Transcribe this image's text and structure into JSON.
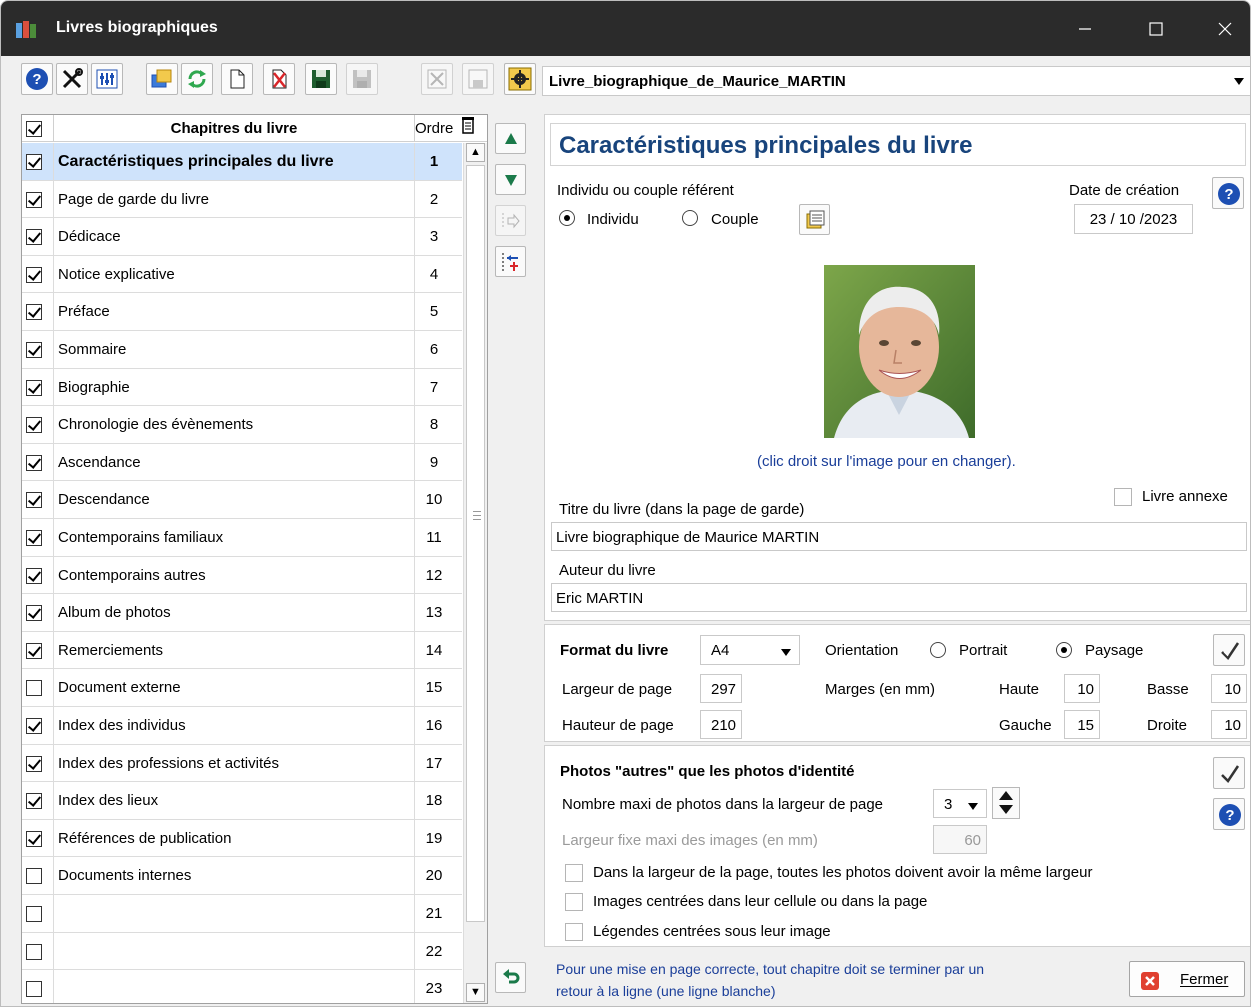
{
  "window": {
    "title": "Livres biographiques"
  },
  "toolbar": {
    "book_selector": "Livre_biographique_de_Maurice_MARTIN"
  },
  "chapters": {
    "header_name": "Chapitres du livre",
    "header_order": "Ordre",
    "rows": [
      {
        "label": "Caractéristiques principales du livre",
        "order": "1",
        "checked": true
      },
      {
        "label": "Page de garde du livre",
        "order": "2",
        "checked": true
      },
      {
        "label": "Dédicace",
        "order": "3",
        "checked": true
      },
      {
        "label": "Notice explicative",
        "order": "4",
        "checked": true
      },
      {
        "label": "Préface",
        "order": "5",
        "checked": true
      },
      {
        "label": "Sommaire",
        "order": "6",
        "checked": true
      },
      {
        "label": "Biographie",
        "order": "7",
        "checked": true
      },
      {
        "label": "Chronologie des évènements",
        "order": "8",
        "checked": true
      },
      {
        "label": "Ascendance",
        "order": "9",
        "checked": true
      },
      {
        "label": "Descendance",
        "order": "10",
        "checked": true
      },
      {
        "label": "Contemporains familiaux",
        "order": "11",
        "checked": true
      },
      {
        "label": "Contemporains autres",
        "order": "12",
        "checked": true
      },
      {
        "label": "Album de photos",
        "order": "13",
        "checked": true
      },
      {
        "label": "Remerciements",
        "order": "14",
        "checked": true
      },
      {
        "label": "Document externe",
        "order": "15",
        "checked": false
      },
      {
        "label": "Index des individus",
        "order": "16",
        "checked": true
      },
      {
        "label": "Index des professions et activités",
        "order": "17",
        "checked": true
      },
      {
        "label": "Index des lieux",
        "order": "18",
        "checked": true
      },
      {
        "label": "Références de publication",
        "order": "19",
        "checked": true
      },
      {
        "label": "Documents internes",
        "order": "20",
        "checked": false
      },
      {
        "label": "",
        "order": "21",
        "checked": false
      },
      {
        "label": "",
        "order": "22",
        "checked": false
      },
      {
        "label": "",
        "order": "23",
        "checked": false
      }
    ]
  },
  "main": {
    "caption": "Caractéristiques principales du livre",
    "referent_label": "Individu ou couple référent",
    "radio_individu": "Individu",
    "radio_couple": "Couple",
    "creation_date_label": "Date de création",
    "creation_date": "23 / 10 /2023",
    "photo_hint": "(clic droit sur l'image pour en changer).",
    "annex_label": "Livre annexe",
    "title_label": "Titre du livre (dans la page de garde)",
    "title_value": "Livre biographique de Maurice MARTIN",
    "author_label": "Auteur du livre",
    "author_value": "Eric MARTIN"
  },
  "format": {
    "format_label": "Format du livre",
    "format_value": "A4",
    "orientation_label": "Orientation",
    "portrait": "Portrait",
    "paysage": "Paysage",
    "width_label": "Largeur de page",
    "width_value": "297",
    "height_label": "Hauteur de page",
    "height_value": "210",
    "margins_label": "Marges  (en mm)",
    "top_label": "Haute",
    "top_value": "10",
    "bottom_label": "Basse",
    "bottom_value": "10",
    "left_label": "Gauche",
    "left_value": "15",
    "right_label": "Droite",
    "right_value": "10"
  },
  "photos": {
    "heading": "Photos \"autres\" que les photos d'identité",
    "max_label": "Nombre maxi de photos dans la largeur de page",
    "max_value": "3",
    "fixed_label": "Largeur fixe maxi des images (en mm)",
    "fixed_value": "60",
    "opt1": "Dans la largeur de la page, toutes les photos doivent avoir la même largeur",
    "opt2": "Images centrées dans leur cellule ou dans la page",
    "opt3": "Légendes centrées sous leur image"
  },
  "footer": {
    "note_line1": "Pour une mise en page correcte, tout chapitre doit se terminer par un",
    "note_line2": "retour à la ligne (une ligne blanche)",
    "close_label": "Fermer"
  }
}
